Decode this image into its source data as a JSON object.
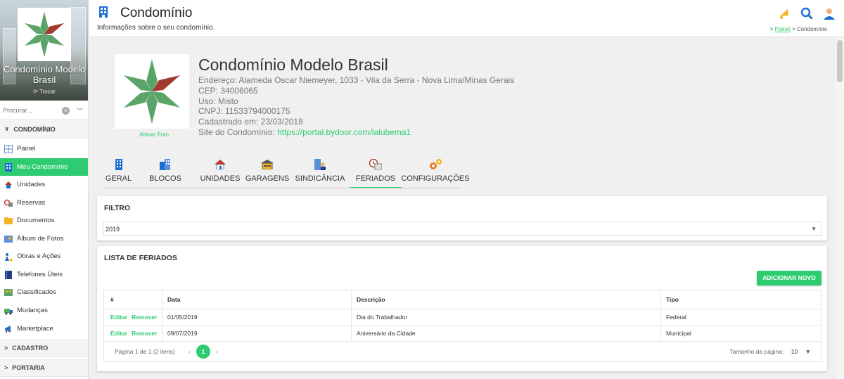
{
  "sidebar": {
    "condo_name": "Condomínio Modelo Brasil",
    "switch_label": "Trocar",
    "search_placeholder": "Procurar...",
    "sections": {
      "condominio": "CONDOMÍNIO",
      "cadastro": "CADASTRO",
      "portaria": "PORTARIA"
    },
    "items": [
      {
        "label": "Painel",
        "icon": "dashboard-icon"
      },
      {
        "label": "Meu Condomínio",
        "icon": "building-icon",
        "active": true
      },
      {
        "label": "Unidades",
        "icon": "house-icon"
      },
      {
        "label": "Reservas",
        "icon": "reservation-icon"
      },
      {
        "label": "Documentos",
        "icon": "folder-icon"
      },
      {
        "label": "Álbum de Fotos",
        "icon": "photo-icon"
      },
      {
        "label": "Obras e Ações",
        "icon": "construction-icon"
      },
      {
        "label": "Telefones Úteis",
        "icon": "phonebook-icon"
      },
      {
        "label": "Classificados",
        "icon": "classifieds-icon"
      },
      {
        "label": "Mudanças",
        "icon": "truck-icon"
      },
      {
        "label": "Marketplace",
        "icon": "megaphone-icon"
      }
    ]
  },
  "header": {
    "title": "Condomínio",
    "subtitle": "Informações sobre o seu condomínio.",
    "breadcrumb": {
      "home": "Painel",
      "current": "Condomínio"
    }
  },
  "condo": {
    "name": "Condomínio Modelo Brasil",
    "address": "Endereço: Alameda Oscar Niemeyer, 1033 - Vila da Serra - Nova Lima/Minas Gerais",
    "cep": "CEP: 34006065",
    "uso": "Uso: Misto",
    "cnpj": "CNPJ: 11533794000175",
    "cadastrado": "Cadastrado em: 23/03/2018",
    "site_label": "Site do Condomínio:",
    "site_url": "https://portal.bydoor.com/lalubema1",
    "change_photo": "Alterar Foto"
  },
  "tabs": [
    {
      "label": "GERAL",
      "icon": "building-icon"
    },
    {
      "label": "BLOCOS",
      "icon": "blocks-icon"
    },
    {
      "label": "UNIDADES",
      "icon": "house-icon"
    },
    {
      "label": "GARAGENS",
      "icon": "garage-icon"
    },
    {
      "label": "SINDICÂNCIA",
      "icon": "manager-icon"
    },
    {
      "label": "FERIADOS",
      "icon": "calendar-icon",
      "active": true
    },
    {
      "label": "CONFIGURAÇÕES",
      "icon": "gears-icon"
    }
  ],
  "filter": {
    "title": "FILTRO",
    "year": "2019"
  },
  "holidays": {
    "title": "LISTA DE FERIADOS",
    "add_label": "ADICIONAR NOVO",
    "columns": [
      "#",
      "Data",
      "Descrição",
      "Tipo"
    ],
    "edit_label": "Editar",
    "remove_label": "Remover",
    "rows": [
      {
        "date": "01/05/2019",
        "description": "Dia do Trabalhador",
        "type": "Federal"
      },
      {
        "date": "09/07/2019",
        "description": "Aniversário da Cidade",
        "type": "Municipal"
      }
    ],
    "pager_info": "Página 1 de 1 (2 itens)",
    "page": "1",
    "page_size_label": "Tamanho da página:",
    "page_size": "10"
  },
  "colors": {
    "accent": "#2ecc71",
    "brand_blue": "#1a6fd1"
  }
}
